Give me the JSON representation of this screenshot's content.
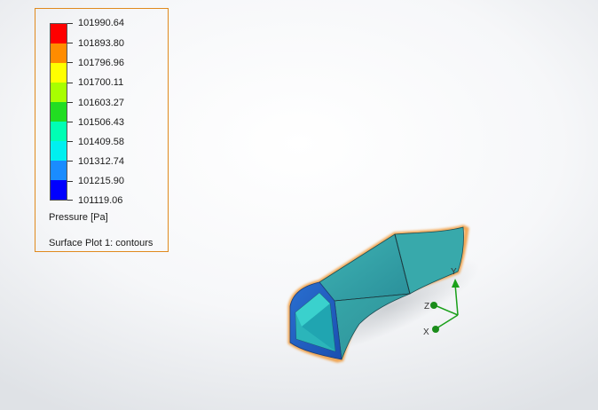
{
  "legend": {
    "values": [
      "101990.64",
      "101893.80",
      "101796.96",
      "101700.11",
      "101603.27",
      "101506.43",
      "101409.58",
      "101312.74",
      "101215.90",
      "101119.06"
    ],
    "colors": [
      "#ff0000",
      "#ff8c00",
      "#ffff00",
      "#a8ff00",
      "#22dd22",
      "#00ffb4",
      "#00f0f0",
      "#1a8cff",
      "#0000ff"
    ],
    "quantity": "Pressure [Pa]",
    "plot_name": "Surface Plot 1: contours",
    "border_color": "#e08a1e"
  },
  "triad": {
    "x_label": "X",
    "y_label": "Y",
    "z_label": "Z",
    "axis_color": "#1aa01a"
  },
  "model": {
    "highlight_color": "#f08c1a",
    "face_color_main": "#3aa9a9",
    "face_color_end": "#1a66c8"
  }
}
